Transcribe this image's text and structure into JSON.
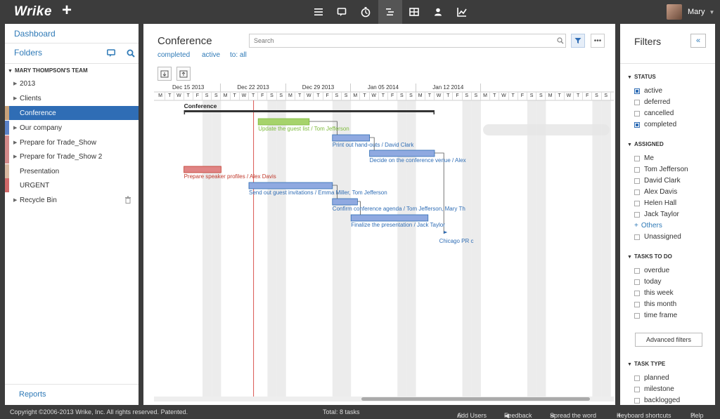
{
  "topbar": {
    "logo": "Wrike",
    "plus": "+",
    "user_name": "Mary",
    "nav_icons": [
      "list-icon",
      "comment-icon",
      "timer-icon",
      "gantt-icon",
      "table-icon",
      "user-icon",
      "chart-icon"
    ],
    "active_icon": "gantt-icon"
  },
  "sidebar": {
    "dashboard": "Dashboard",
    "folders": "Folders",
    "team": "MARY THOMPSON'S TEAM",
    "items": [
      {
        "label": "2013",
        "arrow": true,
        "color": ""
      },
      {
        "label": "Clients",
        "arrow": true,
        "color": ""
      },
      {
        "label": "Conference",
        "arrow": false,
        "color": "#c8a27a",
        "selected": true
      },
      {
        "label": "Our company",
        "arrow": true,
        "color": "#5b82c8"
      },
      {
        "label": "Prepare for Trade_Show",
        "arrow": true,
        "color": "#d38a8a"
      },
      {
        "label": "Prepare for Trade_Show 2",
        "arrow": true,
        "color": "#d38a8a"
      },
      {
        "label": "Presentation",
        "arrow": false,
        "color": "#d9b8a0"
      },
      {
        "label": "URGENT",
        "arrow": false,
        "color": "#d16a6a"
      },
      {
        "label": "Recycle Bin",
        "arrow": true,
        "color": ""
      }
    ],
    "reports": "Reports"
  },
  "main": {
    "title": "Conference",
    "tabs": [
      "completed",
      "active",
      "to: all"
    ],
    "search_placeholder": "Search",
    "more": "•••"
  },
  "gantt": {
    "weeks": [
      "Dec 15 2013",
      "Dec 22 2013",
      "Dec 29 2013",
      "Jan 05 2014",
      "Jan 12 2014"
    ],
    "days": [
      "M",
      "T",
      "W",
      "T",
      "F",
      "S",
      "S"
    ],
    "project_label": "Conference",
    "tasks": [
      {
        "label": "Update the guest list / Tom Jefferson",
        "color": "#7dbb3c",
        "fill": "#a6d36b"
      },
      {
        "label": "Print out hand-outs / David Clark",
        "color": "#2f6db5",
        "fill": "#8fa9e0"
      },
      {
        "label": "Decide on the conference venue / Alex",
        "color": "#2f6db5",
        "fill": "#8fa9e0"
      },
      {
        "label": "Prepare speaker profiles / Alex Davis",
        "color": "#c0392b",
        "fill": "#e08585"
      },
      {
        "label": "Send out guest invitations / Emma Miller, Tom Jefferson",
        "color": "#2f6db5",
        "fill": "#8fa9e0"
      },
      {
        "label": "Confirm conference agenda / Tom Jefferson, Mary Th",
        "color": "#2f6db5",
        "fill": "#8fa9e0"
      },
      {
        "label": "Finalize the presentation / Jack Taylor",
        "color": "#2f6db5",
        "fill": "#8fa9e0"
      },
      {
        "label": "Chicago PR c",
        "color": "#2f6db5",
        "fill": ""
      }
    ]
  },
  "filters": {
    "title": "Filters",
    "collapse": "«",
    "status_head": "STATUS",
    "status": [
      {
        "label": "active",
        "checked": true
      },
      {
        "label": "deferred",
        "checked": false
      },
      {
        "label": "cancelled",
        "checked": false
      },
      {
        "label": "completed",
        "checked": true
      }
    ],
    "assigned_head": "ASSIGNED",
    "assigned": [
      "Me",
      "Tom Jefferson",
      "David Clark",
      "Alex Davis",
      "Helen Hall",
      "Jack Taylor"
    ],
    "others": "Others",
    "unassigned": "Unassigned",
    "todo_head": "TASKS TO DO",
    "todo": [
      "overdue",
      "today",
      "this week",
      "this month",
      "time frame"
    ],
    "advanced": "Advanced filters",
    "type_head": "TASK TYPE",
    "types": [
      "planned",
      "milestone",
      "backlogged"
    ]
  },
  "footer": {
    "copyright": "Copyright ©2006-2013 Wrike, Inc. All rights reserved. Patented.",
    "total": "Total: 8 tasks",
    "add_users": "Add Users",
    "feedback": "Feedback",
    "spread": "Spread the word",
    "shortcuts": "Keyboard shortcuts",
    "help": "Help"
  }
}
